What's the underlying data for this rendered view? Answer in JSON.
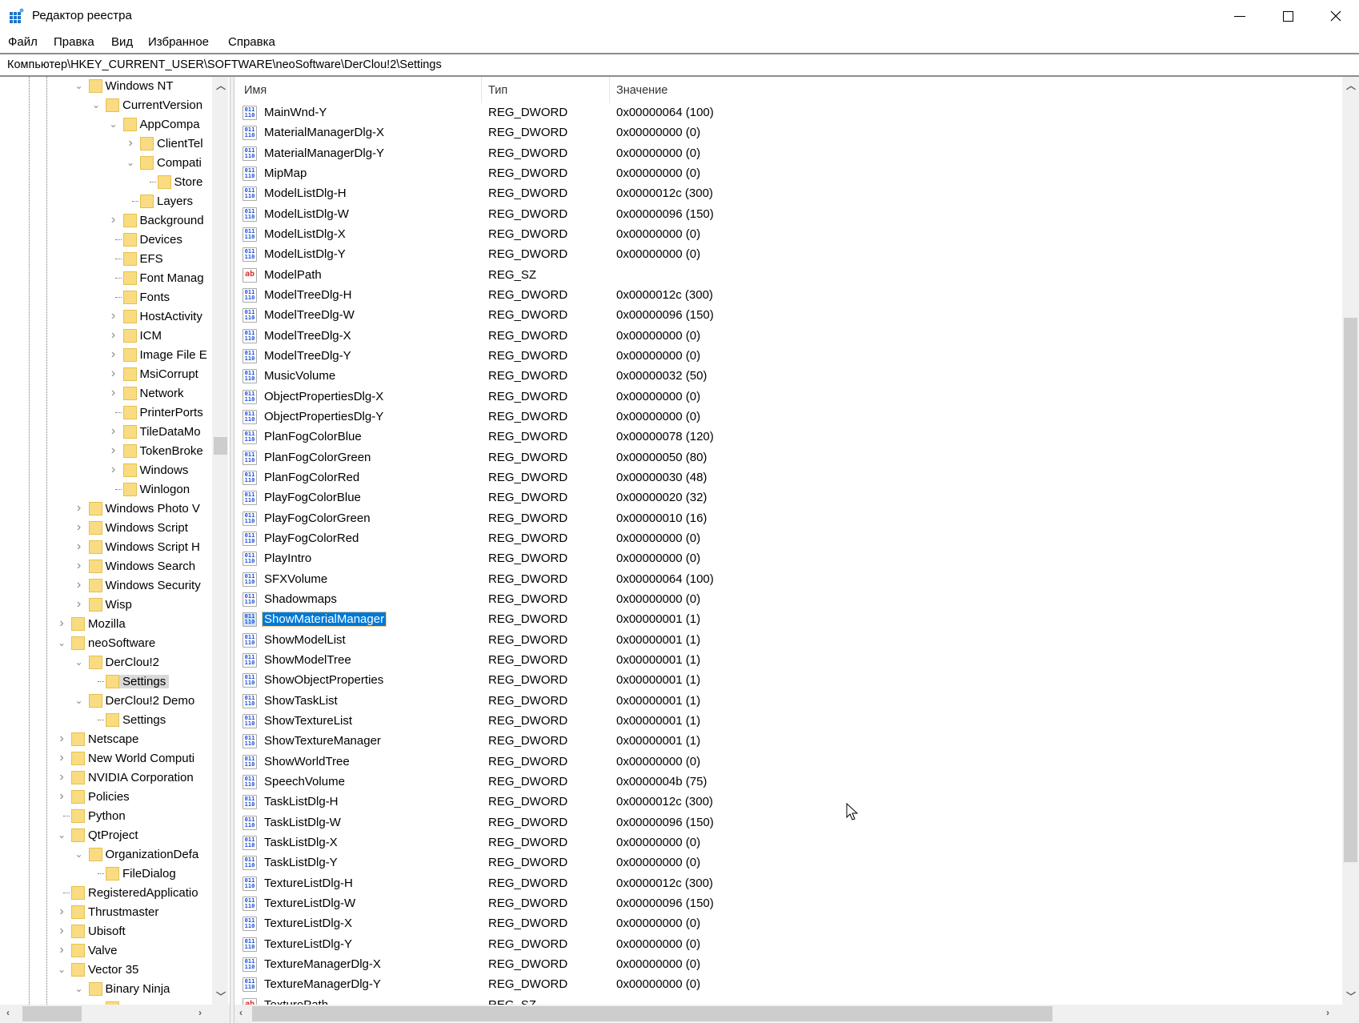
{
  "window": {
    "title": "Редактор реестра",
    "controls": {
      "minimize": "—",
      "maximize": "☐",
      "close": "✕"
    }
  },
  "menu": [
    "Файл",
    "Правка",
    "Вид",
    "Избранное",
    "Справка"
  ],
  "address": "Компьютер\\HKEY_CURRENT_USER\\SOFTWARE\\neoSoftware\\DerClou!2\\Settings",
  "colors": {
    "selection": "#0078d7",
    "folder": "#f9dc82",
    "tree_selection": "#d9d9d9"
  },
  "tree": [
    {
      "label": "Windows NT",
      "level": 1,
      "state": "open"
    },
    {
      "label": "CurrentVersion",
      "level": 2,
      "state": "open"
    },
    {
      "label": "AppCompa",
      "level": 3,
      "state": "open"
    },
    {
      "label": "ClientTel",
      "level": 4,
      "state": "closed"
    },
    {
      "label": "Compati",
      "level": 4,
      "state": "open"
    },
    {
      "label": "Store",
      "level": 5,
      "state": "leaf"
    },
    {
      "label": "Layers",
      "level": 4,
      "state": "leaf"
    },
    {
      "label": "Background",
      "level": 3,
      "state": "closed"
    },
    {
      "label": "Devices",
      "level": 3,
      "state": "leaf"
    },
    {
      "label": "EFS",
      "level": 3,
      "state": "leaf"
    },
    {
      "label": "Font Manag",
      "level": 3,
      "state": "leaf"
    },
    {
      "label": "Fonts",
      "level": 3,
      "state": "leaf"
    },
    {
      "label": "HostActivity",
      "level": 3,
      "state": "closed"
    },
    {
      "label": "ICM",
      "level": 3,
      "state": "closed"
    },
    {
      "label": "Image File E",
      "level": 3,
      "state": "closed"
    },
    {
      "label": "MsiCorrupt",
      "level": 3,
      "state": "closed"
    },
    {
      "label": "Network",
      "level": 3,
      "state": "closed"
    },
    {
      "label": "PrinterPorts",
      "level": 3,
      "state": "leaf"
    },
    {
      "label": "TileDataMo",
      "level": 3,
      "state": "closed"
    },
    {
      "label": "TokenBroke",
      "level": 3,
      "state": "closed"
    },
    {
      "label": "Windows",
      "level": 3,
      "state": "closed"
    },
    {
      "label": "Winlogon",
      "level": 3,
      "state": "leaf"
    },
    {
      "label": "Windows Photo V",
      "level": 1,
      "state": "closed"
    },
    {
      "label": "Windows Script",
      "level": 1,
      "state": "closed"
    },
    {
      "label": "Windows Script H",
      "level": 1,
      "state": "closed"
    },
    {
      "label": "Windows Search",
      "level": 1,
      "state": "closed"
    },
    {
      "label": "Windows Security",
      "level": 1,
      "state": "closed"
    },
    {
      "label": "Wisp",
      "level": 1,
      "state": "closed"
    },
    {
      "label": "Mozilla",
      "level": 0,
      "state": "closed"
    },
    {
      "label": "neoSoftware",
      "level": 0,
      "state": "open"
    },
    {
      "label": "DerClou!2",
      "level": 1,
      "state": "open"
    },
    {
      "label": "Settings",
      "level": 2,
      "state": "leaf",
      "selected": true
    },
    {
      "label": "DerClou!2 Demo",
      "level": 1,
      "state": "open"
    },
    {
      "label": "Settings",
      "level": 2,
      "state": "leaf"
    },
    {
      "label": "Netscape",
      "level": 0,
      "state": "closed"
    },
    {
      "label": "New World Computi",
      "level": 0,
      "state": "closed"
    },
    {
      "label": "NVIDIA Corporation",
      "level": 0,
      "state": "closed"
    },
    {
      "label": "Policies",
      "level": 0,
      "state": "closed"
    },
    {
      "label": "Python",
      "level": 0,
      "state": "leaf"
    },
    {
      "label": "QtProject",
      "level": 0,
      "state": "open"
    },
    {
      "label": "OrganizationDefa",
      "level": 1,
      "state": "open"
    },
    {
      "label": "FileDialog",
      "level": 2,
      "state": "leaf"
    },
    {
      "label": "RegisteredApplicatio",
      "level": 0,
      "state": "leaf"
    },
    {
      "label": "Thrustmaster",
      "level": 0,
      "state": "closed"
    },
    {
      "label": "Ubisoft",
      "level": 0,
      "state": "closed"
    },
    {
      "label": "Valve",
      "level": 0,
      "state": "closed"
    },
    {
      "label": "Vector 35",
      "level": 0,
      "state": "open"
    },
    {
      "label": "Binary Ninja",
      "level": 1,
      "state": "open"
    },
    {
      "label": "",
      "level": 2,
      "state": "leaf"
    }
  ],
  "list": {
    "columns": [
      "Имя",
      "Тип",
      "Значение"
    ],
    "rows": [
      {
        "name": "MainWnd-Y",
        "type": "REG_DWORD",
        "value": "0x00000064 (100)"
      },
      {
        "name": "MaterialManagerDlg-X",
        "type": "REG_DWORD",
        "value": "0x00000000 (0)"
      },
      {
        "name": "MaterialManagerDlg-Y",
        "type": "REG_DWORD",
        "value": "0x00000000 (0)"
      },
      {
        "name": "MipMap",
        "type": "REG_DWORD",
        "value": "0x00000000 (0)"
      },
      {
        "name": "ModelListDlg-H",
        "type": "REG_DWORD",
        "value": "0x0000012c (300)"
      },
      {
        "name": "ModelListDlg-W",
        "type": "REG_DWORD",
        "value": "0x00000096 (150)"
      },
      {
        "name": "ModelListDlg-X",
        "type": "REG_DWORD",
        "value": "0x00000000 (0)"
      },
      {
        "name": "ModelListDlg-Y",
        "type": "REG_DWORD",
        "value": "0x00000000 (0)"
      },
      {
        "name": "ModelPath",
        "type": "REG_SZ",
        "value": ""
      },
      {
        "name": "ModelTreeDlg-H",
        "type": "REG_DWORD",
        "value": "0x0000012c (300)"
      },
      {
        "name": "ModelTreeDlg-W",
        "type": "REG_DWORD",
        "value": "0x00000096 (150)"
      },
      {
        "name": "ModelTreeDlg-X",
        "type": "REG_DWORD",
        "value": "0x00000000 (0)"
      },
      {
        "name": "ModelTreeDlg-Y",
        "type": "REG_DWORD",
        "value": "0x00000000 (0)"
      },
      {
        "name": "MusicVolume",
        "type": "REG_DWORD",
        "value": "0x00000032 (50)"
      },
      {
        "name": "ObjectPropertiesDlg-X",
        "type": "REG_DWORD",
        "value": "0x00000000 (0)"
      },
      {
        "name": "ObjectPropertiesDlg-Y",
        "type": "REG_DWORD",
        "value": "0x00000000 (0)"
      },
      {
        "name": "PlanFogColorBlue",
        "type": "REG_DWORD",
        "value": "0x00000078 (120)"
      },
      {
        "name": "PlanFogColorGreen",
        "type": "REG_DWORD",
        "value": "0x00000050 (80)"
      },
      {
        "name": "PlanFogColorRed",
        "type": "REG_DWORD",
        "value": "0x00000030 (48)"
      },
      {
        "name": "PlayFogColorBlue",
        "type": "REG_DWORD",
        "value": "0x00000020 (32)"
      },
      {
        "name": "PlayFogColorGreen",
        "type": "REG_DWORD",
        "value": "0x00000010 (16)"
      },
      {
        "name": "PlayFogColorRed",
        "type": "REG_DWORD",
        "value": "0x00000000 (0)"
      },
      {
        "name": "PlayIntro",
        "type": "REG_DWORD",
        "value": "0x00000000 (0)"
      },
      {
        "name": "SFXVolume",
        "type": "REG_DWORD",
        "value": "0x00000064 (100)"
      },
      {
        "name": "Shadowmaps",
        "type": "REG_DWORD",
        "value": "0x00000000 (0)"
      },
      {
        "name": "ShowMaterialManager",
        "type": "REG_DWORD",
        "value": "0x00000001 (1)",
        "selected": true
      },
      {
        "name": "ShowModelList",
        "type": "REG_DWORD",
        "value": "0x00000001 (1)"
      },
      {
        "name": "ShowModelTree",
        "type": "REG_DWORD",
        "value": "0x00000001 (1)"
      },
      {
        "name": "ShowObjectProperties",
        "type": "REG_DWORD",
        "value": "0x00000001 (1)"
      },
      {
        "name": "ShowTaskList",
        "type": "REG_DWORD",
        "value": "0x00000001 (1)"
      },
      {
        "name": "ShowTextureList",
        "type": "REG_DWORD",
        "value": "0x00000001 (1)"
      },
      {
        "name": "ShowTextureManager",
        "type": "REG_DWORD",
        "value": "0x00000001 (1)"
      },
      {
        "name": "ShowWorldTree",
        "type": "REG_DWORD",
        "value": "0x00000000 (0)"
      },
      {
        "name": "SpeechVolume",
        "type": "REG_DWORD",
        "value": "0x0000004b (75)"
      },
      {
        "name": "TaskListDlg-H",
        "type": "REG_DWORD",
        "value": "0x0000012c (300)"
      },
      {
        "name": "TaskListDlg-W",
        "type": "REG_DWORD",
        "value": "0x00000096 (150)"
      },
      {
        "name": "TaskListDlg-X",
        "type": "REG_DWORD",
        "value": "0x00000000 (0)"
      },
      {
        "name": "TaskListDlg-Y",
        "type": "REG_DWORD",
        "value": "0x00000000 (0)"
      },
      {
        "name": "TextureListDlg-H",
        "type": "REG_DWORD",
        "value": "0x0000012c (300)"
      },
      {
        "name": "TextureListDlg-W",
        "type": "REG_DWORD",
        "value": "0x00000096 (150)"
      },
      {
        "name": "TextureListDlg-X",
        "type": "REG_DWORD",
        "value": "0x00000000 (0)"
      },
      {
        "name": "TextureListDlg-Y",
        "type": "REG_DWORD",
        "value": "0x00000000 (0)"
      },
      {
        "name": "TextureManagerDlg-X",
        "type": "REG_DWORD",
        "value": "0x00000000 (0)"
      },
      {
        "name": "TextureManagerDlg-Y",
        "type": "REG_DWORD",
        "value": "0x00000000 (0)"
      },
      {
        "name": "TexturePath",
        "type": "REG_SZ",
        "value": ""
      }
    ]
  },
  "icons": {
    "dword": "011\n110",
    "string": "ab"
  }
}
